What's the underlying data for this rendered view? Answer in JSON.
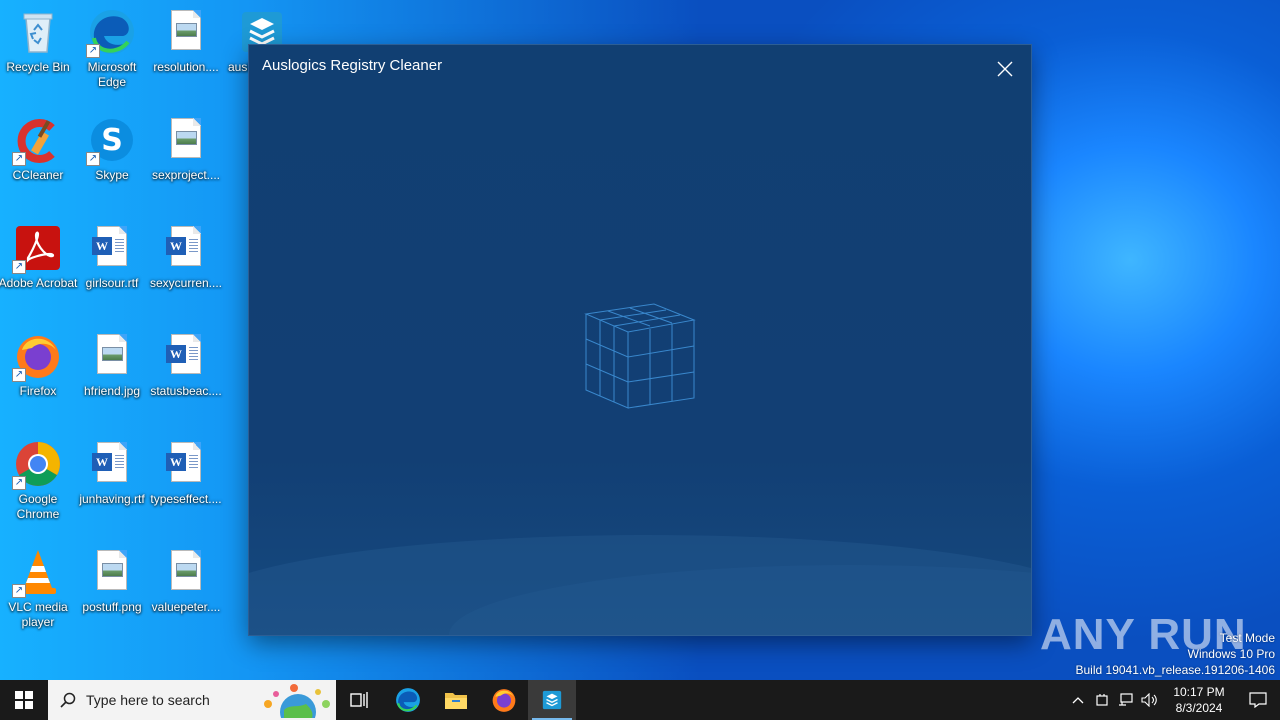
{
  "desktop_icons": [
    {
      "label": "Recycle Bin",
      "icon": "recycle-bin-icon"
    },
    {
      "label": "Microsoft Edge",
      "icon": "edge-icon"
    },
    {
      "label": "resolution....",
      "icon": "image-file-icon"
    },
    {
      "label": "ausl",
      "icon": "auslogics-icon"
    },
    {
      "label": "CCleaner",
      "icon": "ccleaner-icon"
    },
    {
      "label": "Skype",
      "icon": "skype-icon"
    },
    {
      "label": "sexproject....",
      "icon": "image-file-icon"
    },
    {
      "label": "Adobe Acrobat",
      "icon": "acrobat-icon"
    },
    {
      "label": "girlsour.rtf",
      "icon": "word-file-icon"
    },
    {
      "label": "sexycurren....",
      "icon": "word-file-icon"
    },
    {
      "label": "Firefox",
      "icon": "firefox-icon"
    },
    {
      "label": "hfriend.jpg",
      "icon": "image-file-icon"
    },
    {
      "label": "statusbeac....",
      "icon": "word-file-icon"
    },
    {
      "label": "Google Chrome",
      "icon": "chrome-icon"
    },
    {
      "label": "junhaving.rtf",
      "icon": "word-file-icon"
    },
    {
      "label": "typeseffect....",
      "icon": "word-file-icon"
    },
    {
      "label": "VLC media player",
      "icon": "vlc-icon"
    },
    {
      "label": "postuff.png",
      "icon": "image-file-icon"
    },
    {
      "label": "valuepeter....",
      "icon": "image-file-icon"
    }
  ],
  "window": {
    "title": "Auslogics Registry Cleaner",
    "close_icon": "close-icon",
    "loader_icon": "wireframe-cube-icon"
  },
  "watermark": {
    "text": "ANY RUN",
    "test_mode": "Test Mode",
    "os": "Windows 10 Pro",
    "build": "Build 19041.vb_release.191206-1406"
  },
  "taskbar": {
    "search_placeholder": "Type here to search",
    "pinned": [
      "task-view-icon",
      "edge-icon",
      "file-explorer-icon",
      "firefox-icon",
      "auslogics-icon"
    ],
    "clock_time": "10:17 PM",
    "clock_date": "8/3/2024"
  },
  "colors": {
    "window_bg": "#123f74",
    "taskbar_bg": "#1a1a1a",
    "accent": "#76b9ed"
  }
}
